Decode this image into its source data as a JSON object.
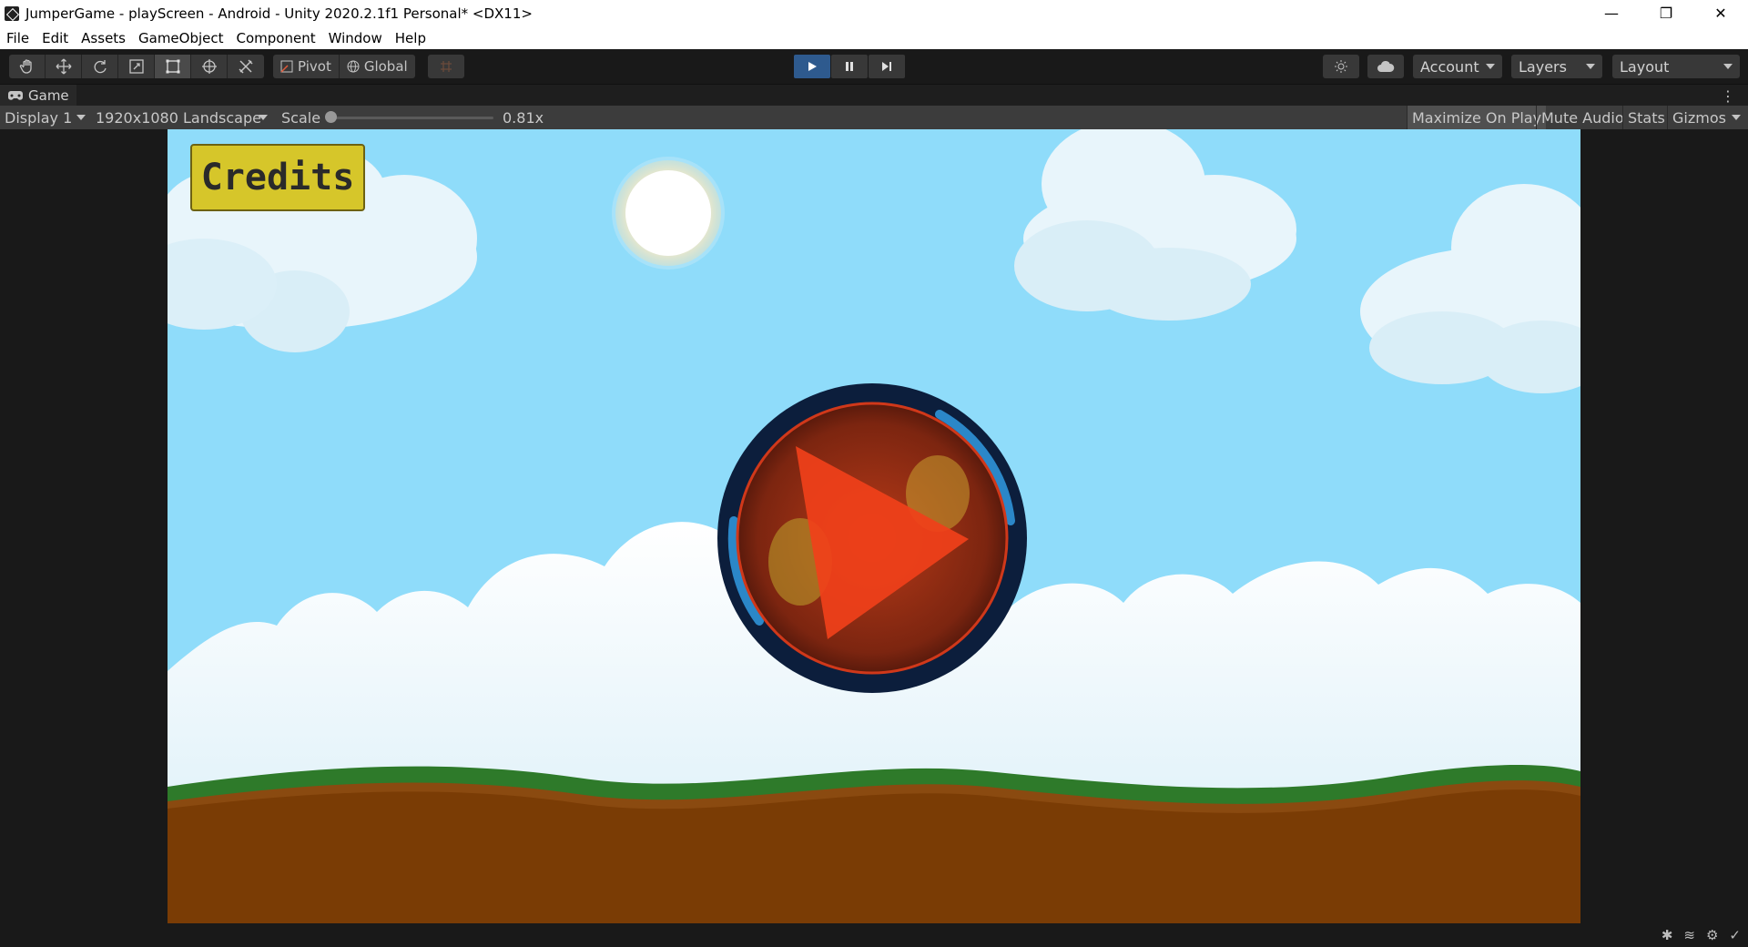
{
  "window": {
    "title": "JumperGame - playScreen - Android - Unity 2020.2.1f1 Personal* <DX11>",
    "minimize": "—",
    "maximize": "❐",
    "close": "✕"
  },
  "menu": {
    "items": [
      "File",
      "Edit",
      "Assets",
      "GameObject",
      "Component",
      "Window",
      "Help"
    ]
  },
  "toolbar": {
    "tools": [
      "hand-icon",
      "move-icon",
      "rotate-icon",
      "scale-icon",
      "rect-icon",
      "transform-icon",
      "custom-tool-icon"
    ],
    "active_tool": "rect-icon",
    "pivot_label": "Pivot",
    "global_label": "Global",
    "account_label": "Account",
    "layers_label": "Layers",
    "layout_label": "Layout",
    "play_state": "playing"
  },
  "game_tab": {
    "label": "Game"
  },
  "game_options": {
    "display": "Display 1",
    "resolution": "1920x1080 Landscape",
    "scale_label": "Scale",
    "scale_value": "0.81x",
    "scale_fraction": 0.0,
    "maximize_on_play": "Maximize On Play",
    "mute_audio": "Mute Audio",
    "stats": "Stats",
    "gizmos": "Gizmos",
    "maximize_on_play_active": true
  },
  "game": {
    "credits_label": "Credits",
    "colors": {
      "sky": "#8fdcfa",
      "grass": "#2e7a2a",
      "dirt": "#7a3c05",
      "play_button_red": "#f0401a",
      "play_ring": "#0c1e3c",
      "credits_yellow": "#d6c62a"
    }
  },
  "colors": {
    "editor_dark": "#191919",
    "play_active": "#2e5a8e"
  }
}
